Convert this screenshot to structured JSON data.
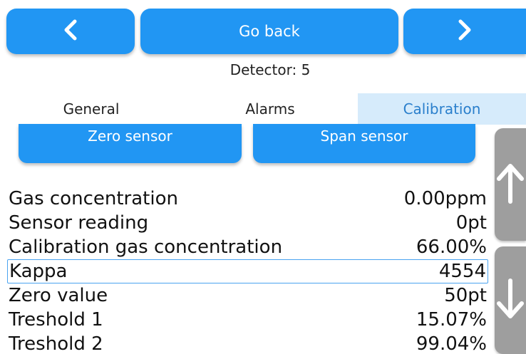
{
  "header": {
    "back_label": "Go back",
    "prev_icon": "chevron-left-icon",
    "next_icon": "chevron-right-icon",
    "detector_label": "Detector: 5"
  },
  "tabs": [
    {
      "label": "General",
      "active": false
    },
    {
      "label": "Alarms",
      "active": false
    },
    {
      "label": "Calibration",
      "active": true
    }
  ],
  "actions": {
    "zero_label": "Zero sensor",
    "span_label": "Span sensor"
  },
  "readings": [
    {
      "label": "Gas concentration",
      "value": "0.00ppm"
    },
    {
      "label": "Sensor reading",
      "value": "0pt"
    },
    {
      "label": "Calibration gas concentration",
      "value": "66.00%"
    },
    {
      "label": "Kappa",
      "value": "4554",
      "selected": true
    },
    {
      "label": "Zero value",
      "value": "50pt"
    },
    {
      "label": "Treshold 1",
      "value": "15.07%"
    },
    {
      "label": "Treshold 2",
      "value": "99.04%"
    }
  ],
  "scroll": {
    "up_icon": "arrow-up-icon",
    "down_icon": "arrow-down-icon"
  },
  "colors": {
    "accent": "#2196f3",
    "active_tab_bg": "#d6ebfb",
    "active_tab_text": "#2a7fcc",
    "scroll_button": "#9e9e9e",
    "selection_border": "#4aa3f0"
  }
}
